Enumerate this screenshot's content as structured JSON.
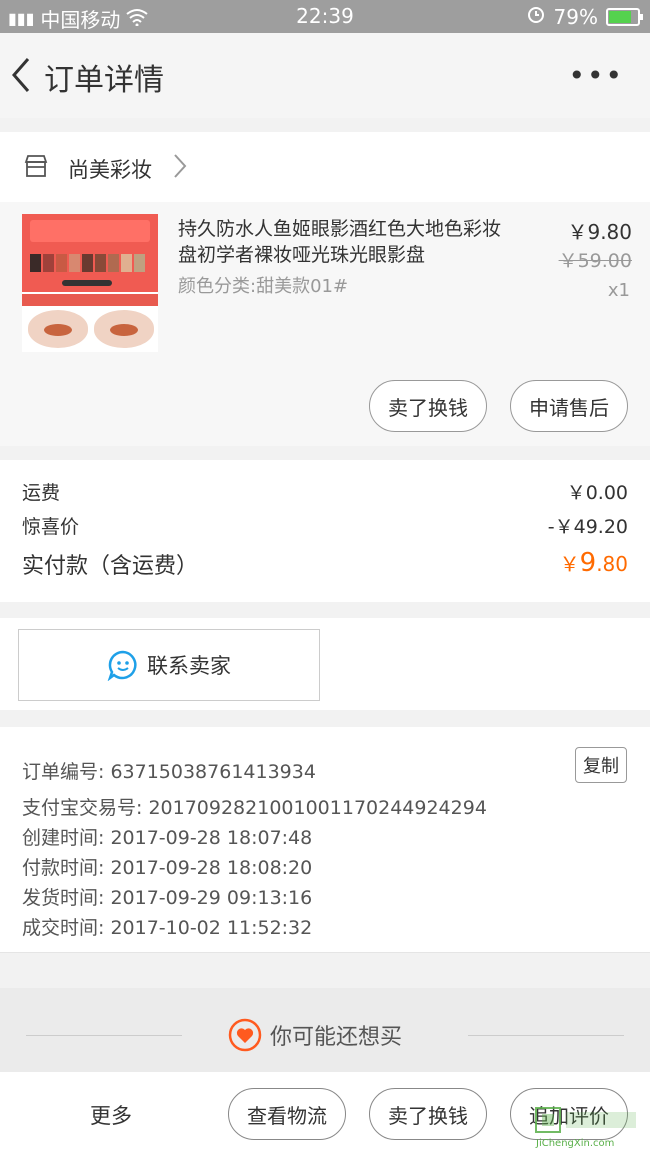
{
  "status_bar": {
    "carrier": "中国移动",
    "time": "22:39",
    "battery": "79%",
    "battery_level": 0.79
  },
  "nav": {
    "title": "订单详情",
    "more": "•••"
  },
  "shop": {
    "name": "尚美彩妆"
  },
  "item": {
    "title": "持久防水人鱼姬眼影酒红色大地色彩妆盘初学者裸妆哑光珠光眼影盘",
    "sku": "颜色分类:甜美款01#",
    "price": "￥9.80",
    "original_price": "￥59.00",
    "quantity": "x1",
    "sell_button": "卖了换钱",
    "after_sale_button": "申请售后"
  },
  "summary": {
    "shipping_label": "运费",
    "shipping_value": "￥0.00",
    "discount_label": "惊喜价",
    "discount_value": "-￥49.20",
    "paid_label": "实付款（含运费）",
    "paid_currency": "￥",
    "paid_integer": "9",
    "paid_decimal": ".80"
  },
  "contact": {
    "label": "联系卖家"
  },
  "order_info": {
    "order_no": "订单编号: 63715038761413934",
    "alipay_no": "支付宝交易号: 2017092821001001170244924294",
    "created": "创建时间: 2017-09-28 18:07:48",
    "paid": "付款时间: 2017-09-28 18:08:20",
    "shipped": "发货时间: 2017-09-29 09:13:16",
    "completed": "成交时间: 2017-10-02 11:52:32",
    "copy_button": "复制"
  },
  "recommend": {
    "label": "你可能还想买"
  },
  "bottom_bar": {
    "more": "更多",
    "logistics": "查看物流",
    "sell": "卖了换钱",
    "add_review": "追加评价"
  },
  "watermark": {
    "text": "JiChengXin.com"
  },
  "colors": {
    "accent": "#ff6a00",
    "chat_blue": "#1ea0e8",
    "heart_orange": "#ff5a1f"
  }
}
